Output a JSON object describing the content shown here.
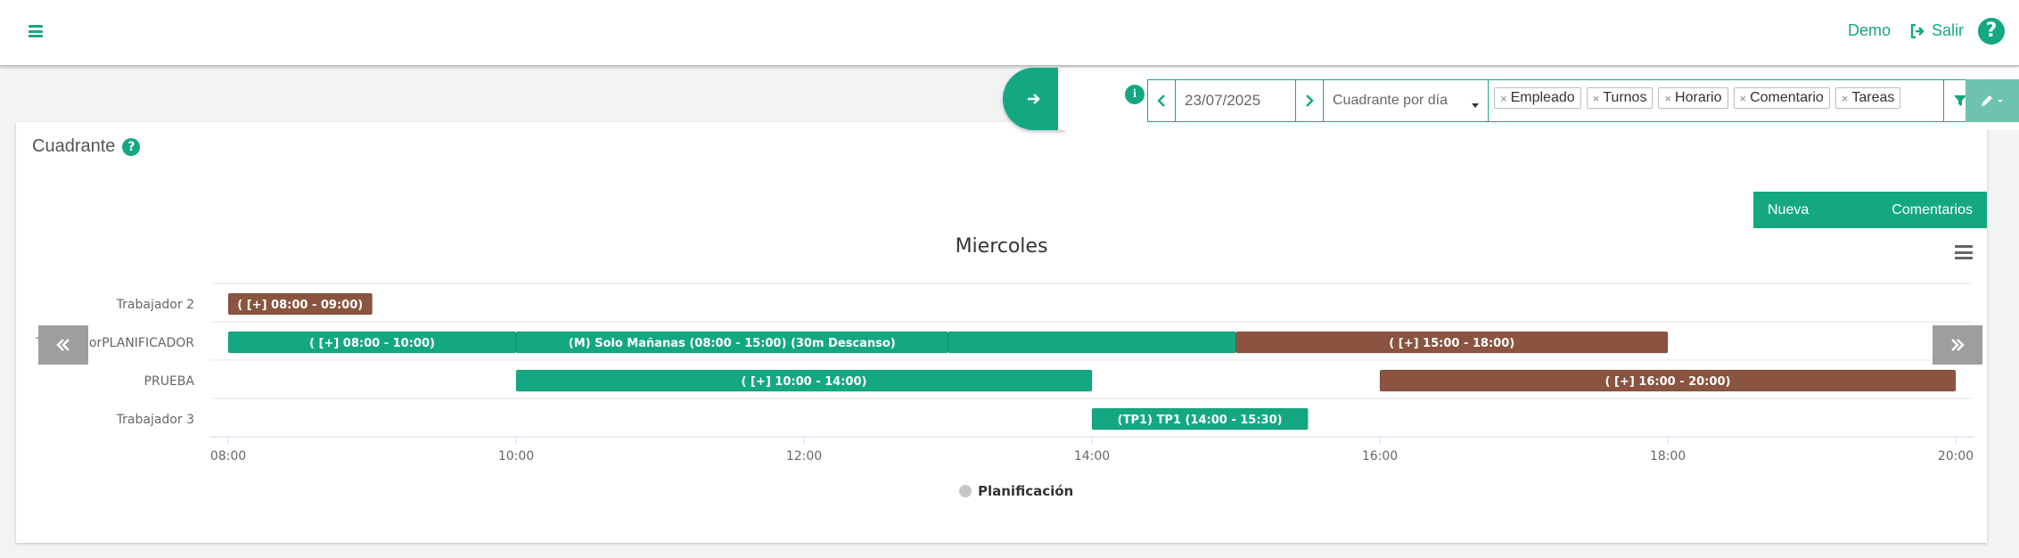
{
  "navbar": {
    "demo_label": "Demo",
    "salir_label": "Salir",
    "help_label": "?"
  },
  "toolbar": {
    "date_value": "23/07/2025",
    "view_select_value": "Cuadrante por día",
    "filters": [
      "Empleado",
      "Turnos",
      "Horario",
      "Comentario",
      "Tareas"
    ],
    "info_label": "i"
  },
  "card": {
    "title": "Cuadrante",
    "help_label": "?",
    "buttons": {
      "new_request": "Nueva Petición",
      "comments": "Comentarios"
    }
  },
  "chart_data": {
    "type": "gantt",
    "title": "Miercoles",
    "categories": [
      "Trabajador 2",
      "TrabajadorPLANIFICADOR",
      "PRUEBA",
      "Trabajador 3"
    ],
    "x_ticks": [
      "08:00",
      "10:00",
      "12:00",
      "14:00",
      "16:00",
      "18:00",
      "20:00"
    ],
    "x_range_hours": [
      8,
      20
    ],
    "legend": [
      "Planificación"
    ],
    "colors": {
      "green": "#14a882",
      "brown": "#8a5440"
    },
    "tasks": [
      {
        "row": 0,
        "start": 8.0,
        "end": 9.0,
        "label": "( [+] 08:00 - 09:00)",
        "color": "brown"
      },
      {
        "row": 1,
        "start": 8.0,
        "end": 10.0,
        "label": "( [+] 08:00 - 10:00)",
        "color": "green"
      },
      {
        "row": 1,
        "start": 10.0,
        "end": 13.0,
        "label": "(M) Solo Mañanas (08:00 - 15:00) (30m Descanso)",
        "color": "green"
      },
      {
        "row": 1,
        "start": 13.0,
        "end": 15.0,
        "label": "",
        "color": "green"
      },
      {
        "row": 1,
        "start": 15.0,
        "end": 18.0,
        "label": "( [+] 15:00 - 18:00)",
        "color": "brown"
      },
      {
        "row": 2,
        "start": 10.0,
        "end": 14.0,
        "label": "( [+] 10:00 - 14:00)",
        "color": "green"
      },
      {
        "row": 2,
        "start": 16.0,
        "end": 20.0,
        "label": "( [+] 16:00 - 20:00)",
        "color": "brown"
      },
      {
        "row": 3,
        "start": 14.0,
        "end": 15.5,
        "label": "(TP1) TP1 (14:00 - 15:30)",
        "color": "green"
      }
    ]
  }
}
